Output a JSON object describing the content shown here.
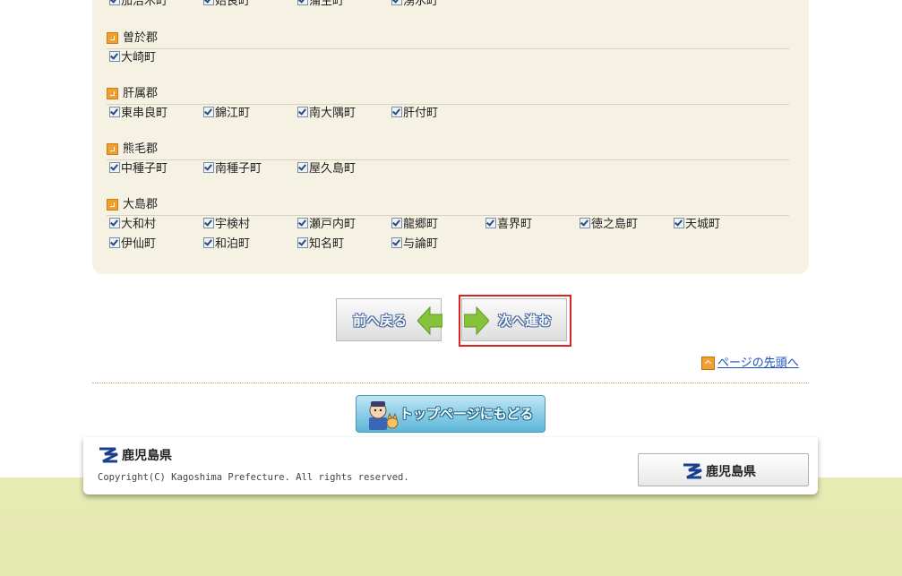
{
  "municipalities": {
    "partial_row": [
      "加治木町",
      "姶良町",
      "蒲生町",
      "湧水町"
    ],
    "groups": [
      {
        "title": "曽於郡",
        "rows": [
          [
            "大崎町"
          ]
        ]
      },
      {
        "title": "肝属郡",
        "rows": [
          [
            "東串良町",
            "錦江町",
            "南大隅町",
            "肝付町"
          ]
        ]
      },
      {
        "title": "熊毛郡",
        "rows": [
          [
            "中種子町",
            "南種子町",
            "屋久島町"
          ]
        ]
      },
      {
        "title": "大島郡",
        "rows": [
          [
            "大和村",
            "宇検村",
            "瀬戸内町",
            "龍郷町",
            "喜界町",
            "徳之島町",
            "天城町"
          ],
          [
            "伊仙町",
            "和泊町",
            "知名町",
            "与論町"
          ]
        ]
      }
    ]
  },
  "nav": {
    "back_label": "前へ戻る",
    "next_label": "次へ進む"
  },
  "page_top_link": "ページの先頭へ",
  "top_page_button": "トップページにもどる",
  "footer": {
    "logo_text": "鹿児島県",
    "copyright": "Copyright(C) Kagoshima Prefecture. All rights reserved.",
    "pref_button": "鹿児島県"
  },
  "colors": {
    "panel_bg": "#f5f1e3",
    "accent_orange": "#f0a030",
    "link_blue": "#1a4fc4",
    "focus_red": "#dd2222"
  }
}
